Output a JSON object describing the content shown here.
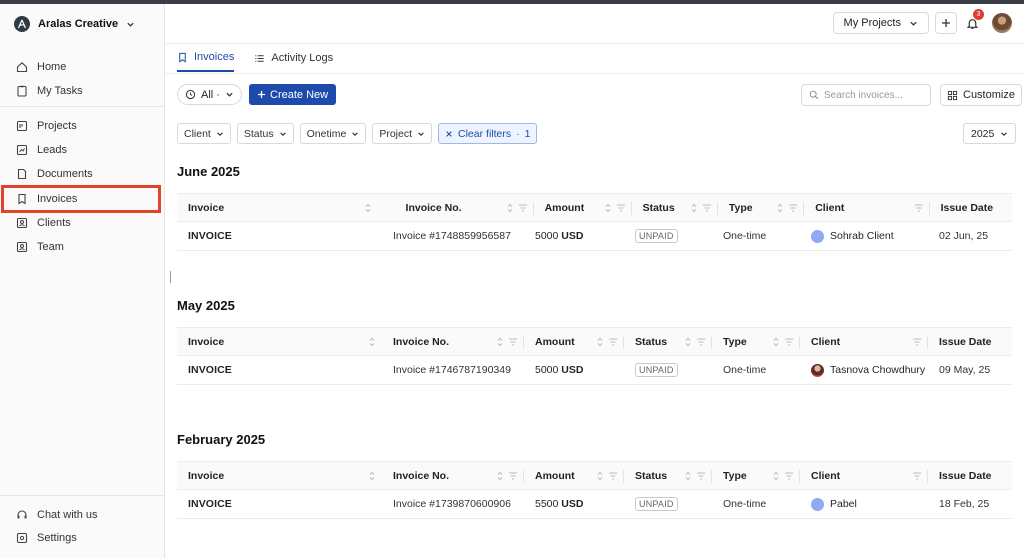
{
  "workspace": {
    "name": "Aralas Creative"
  },
  "sidebar": {
    "top_items": [
      {
        "label": "Home",
        "icon": "home-icon"
      },
      {
        "label": "My Tasks",
        "icon": "clipboard-icon"
      }
    ],
    "items": [
      {
        "label": "Projects",
        "icon": "projects-icon"
      },
      {
        "label": "Leads",
        "icon": "leads-icon"
      },
      {
        "label": "Documents",
        "icon": "document-icon"
      },
      {
        "label": "Invoices",
        "icon": "bookmark-icon",
        "active": true
      },
      {
        "label": "Clients",
        "icon": "contact-card-icon"
      },
      {
        "label": "Team",
        "icon": "team-icon"
      }
    ],
    "bottom_items": [
      {
        "label": "Chat with us",
        "icon": "headset-icon"
      },
      {
        "label": "Settings",
        "icon": "settings-icon"
      }
    ]
  },
  "header": {
    "projects_label": "My Projects",
    "notification_count": "3"
  },
  "tabs": [
    {
      "label": "Invoices",
      "active": true
    },
    {
      "label": "Activity Logs",
      "active": false
    }
  ],
  "toolbar": {
    "all_label": "All ·",
    "create_label": "Create New",
    "search_placeholder": "Search invoices...",
    "customize_label": "Customize",
    "year_label": "2025"
  },
  "filters": {
    "client": "Client",
    "status": "Status",
    "type": "Onetime",
    "project": "Project",
    "clear": "Clear filters",
    "clear_count": "1"
  },
  "columns": [
    "Invoice",
    "Invoice No.",
    "Amount",
    "Status",
    "Type",
    "Client",
    "Issue Date"
  ],
  "groups": [
    {
      "month": "June 2025",
      "rows": [
        {
          "invoice": "INVOICE",
          "number": "Invoice #1748859956587",
          "amount": "5000",
          "currency": "USD",
          "status": "UNPAID",
          "type": "One-time",
          "client": "Sohrab Client",
          "date": "02 Jun, 25"
        }
      ]
    },
    {
      "month": "May 2025",
      "rows": [
        {
          "invoice": "INVOICE",
          "number": "Invoice #1746787190349",
          "amount": "5000",
          "currency": "USD",
          "status": "UNPAID",
          "type": "One-time",
          "client": "Tasnova Chowdhury",
          "date": "09 May, 25"
        }
      ]
    },
    {
      "month": "February 2025",
      "rows": [
        {
          "invoice": "INVOICE",
          "number": "Invoice #1739870600906",
          "amount": "5500",
          "currency": "USD",
          "status": "UNPAID",
          "type": "One-time",
          "client": "Pabel",
          "date": "18 Feb, 25"
        }
      ]
    }
  ],
  "colors": {
    "primary": "#1e4bab",
    "highlight": "#e0442b",
    "badge": "#e03d2f"
  }
}
